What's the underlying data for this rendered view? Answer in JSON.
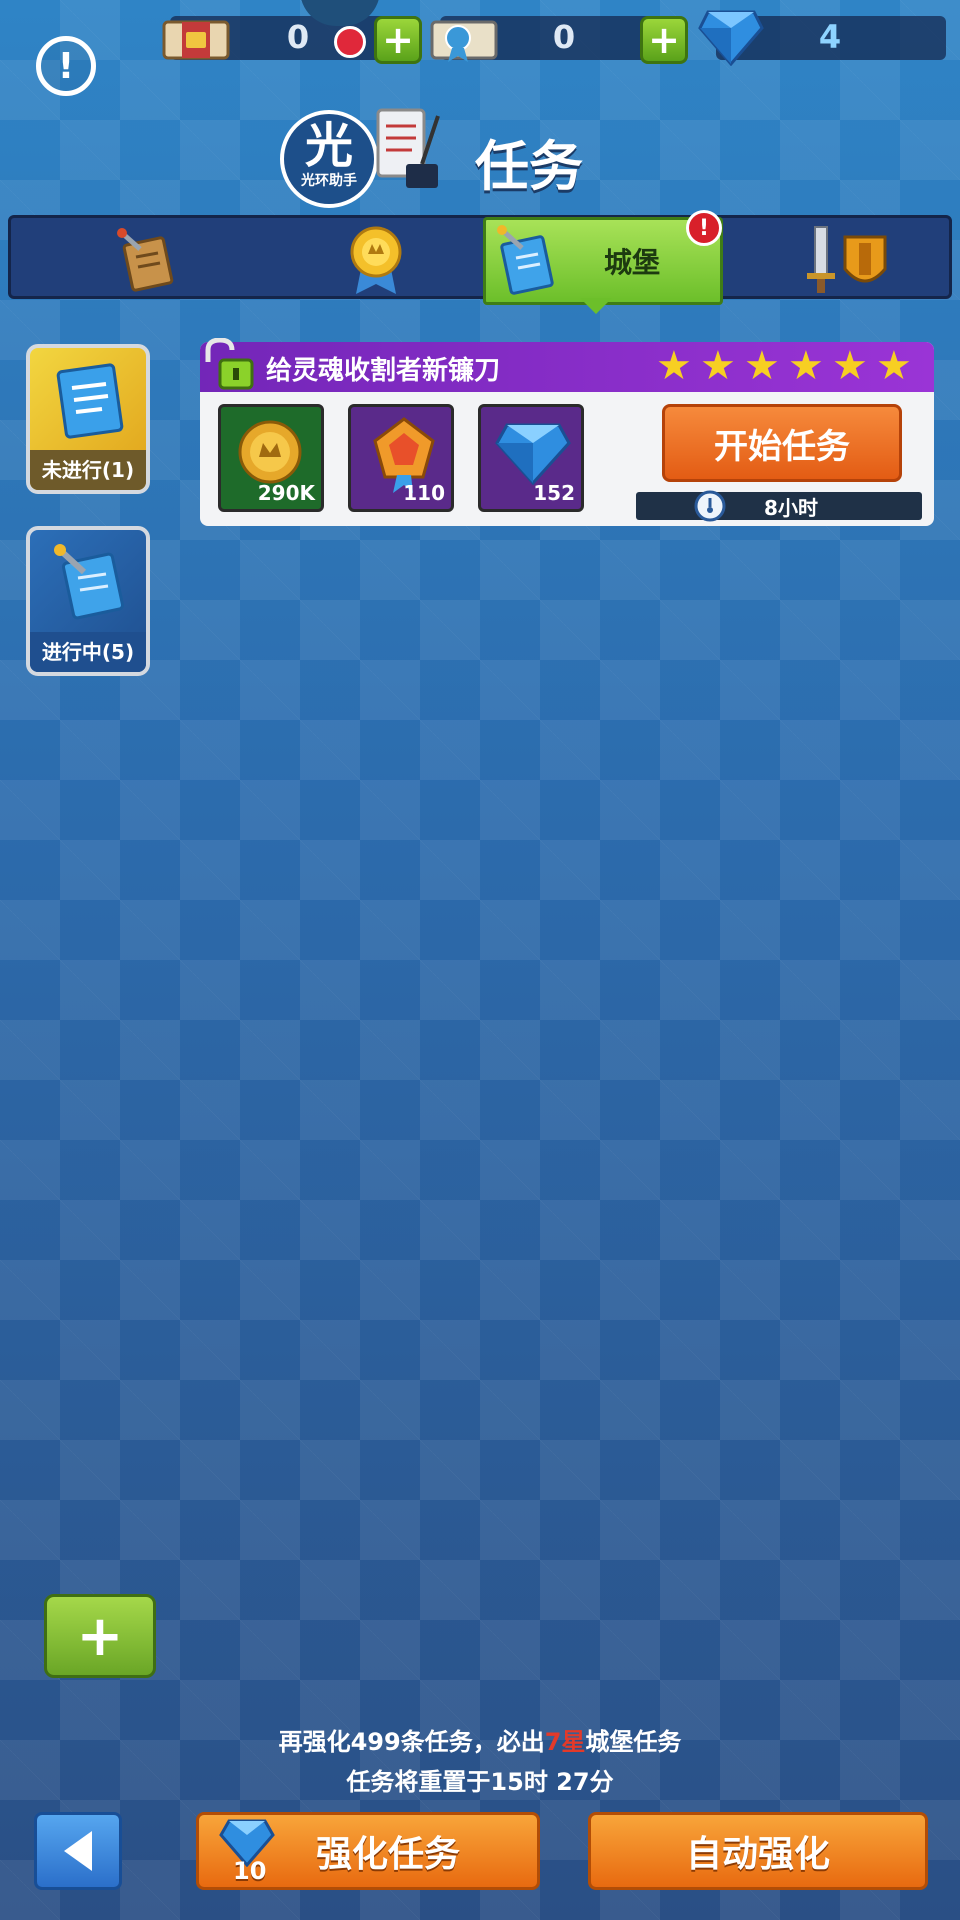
{
  "topbar": {
    "ticket_count": "0",
    "medal_count": "0",
    "gem_count": "4"
  },
  "header": {
    "title": "任务",
    "watermark_big": "光",
    "watermark_small": "光环助手"
  },
  "tabs": [
    {
      "label": "",
      "icon": "quest-scroll-icon"
    },
    {
      "label": "",
      "icon": "medal-icon"
    },
    {
      "label": "城堡",
      "icon": "castle-quest-icon",
      "active": true,
      "badge": "!"
    },
    {
      "label": "",
      "icon": "sword-shield-icon"
    }
  ],
  "side_filters": [
    {
      "label": "未进行(1)"
    },
    {
      "label": "进行中(5)"
    }
  ],
  "quest": {
    "title": "给灵魂收割者新镰刀",
    "stars": 6,
    "rewards": [
      {
        "icon": "gold-coin-icon",
        "amount": "290K"
      },
      {
        "icon": "pentagon-medal-icon",
        "amount": "110"
      },
      {
        "icon": "diamond-icon",
        "amount": "152"
      }
    ],
    "start_label": "开始任务",
    "duration": "8小时"
  },
  "footer": {
    "upgrade_prefix": "再强化499条任务，必出",
    "upgrade_highlight": "7星",
    "upgrade_suffix": "城堡任务",
    "reset_text": "任务将重置于15时 27分",
    "enhance_label": "强化任务",
    "enhance_cost": "10",
    "auto_label": "自动强化"
  },
  "colors": {
    "accent_green": "#6cbf2a",
    "accent_orange": "#e86a10",
    "card_header_purple": "#8a2fc8",
    "highlight_red": "#e23a2a"
  }
}
